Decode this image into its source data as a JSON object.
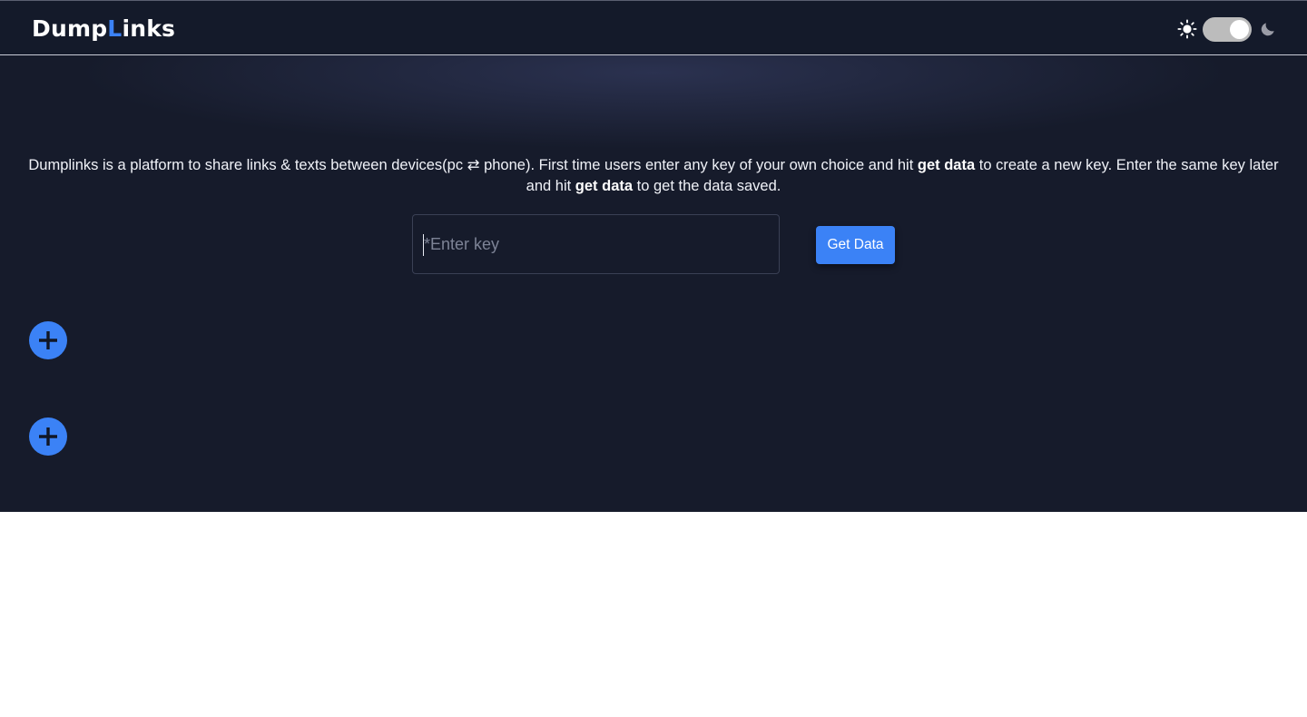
{
  "brand": {
    "part1": "Dump",
    "accent": "L",
    "part2": "inks"
  },
  "theme_toggle": {
    "left_icon": "sun-icon",
    "right_icon": "moon-icon",
    "state": "on"
  },
  "description": {
    "t1": "Dumplinks is a platform to share links & texts between devices(pc ⇄ phone). First time users enter any key of your own choice and hit ",
    "b1": "get data",
    "t2": " to create a new key. Enter the same key later and hit ",
    "b2": "get data",
    "t3": " to get the data saved."
  },
  "key_input": {
    "placeholder": "*Enter key",
    "value": ""
  },
  "get_button": {
    "label": "Get Data"
  },
  "add_buttons": [
    {
      "icon": "plus-icon"
    },
    {
      "icon": "plus-icon"
    }
  ],
  "colors": {
    "accent": "#3b82f6",
    "background": "#161b2b"
  }
}
